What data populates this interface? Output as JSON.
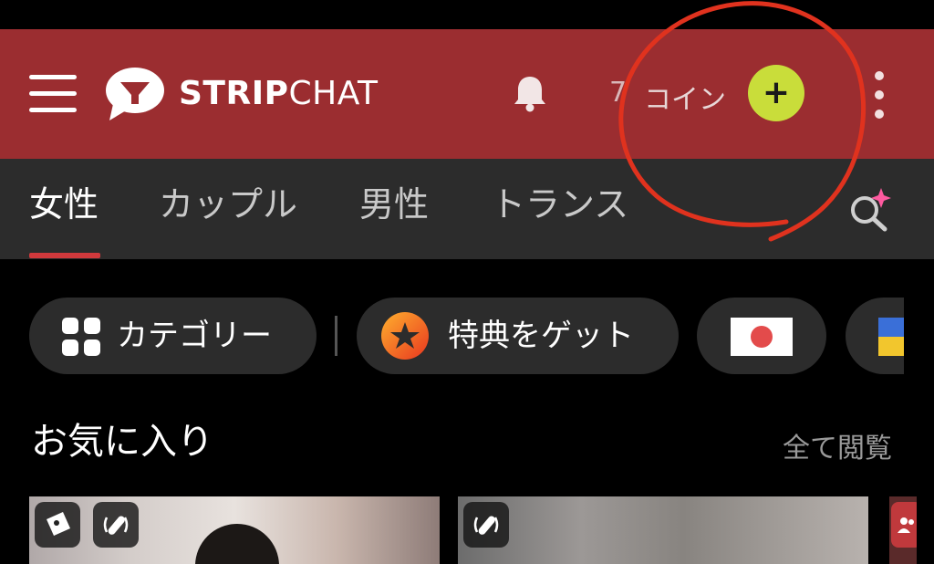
{
  "header": {
    "brand_bold": "STRIP",
    "brand_thin": "CHAT",
    "coin_count": "7",
    "coin_label": "コイン",
    "coin_add": "+",
    "background": "#9b2d30"
  },
  "tabs": [
    {
      "label": "女性",
      "active": true
    },
    {
      "label": "カップル"
    },
    {
      "label": "男性"
    },
    {
      "label": "トランス"
    }
  ],
  "chips": {
    "categories": "カテゴリー",
    "get_bonus": "特典をゲット",
    "flag_japan": "Japan flag",
    "flag_ukraine": "Ukraine flag"
  },
  "favorites": {
    "title": "お気に入り",
    "see_all": "全て閲覧"
  },
  "annotation": {
    "color": "#e0321e"
  }
}
